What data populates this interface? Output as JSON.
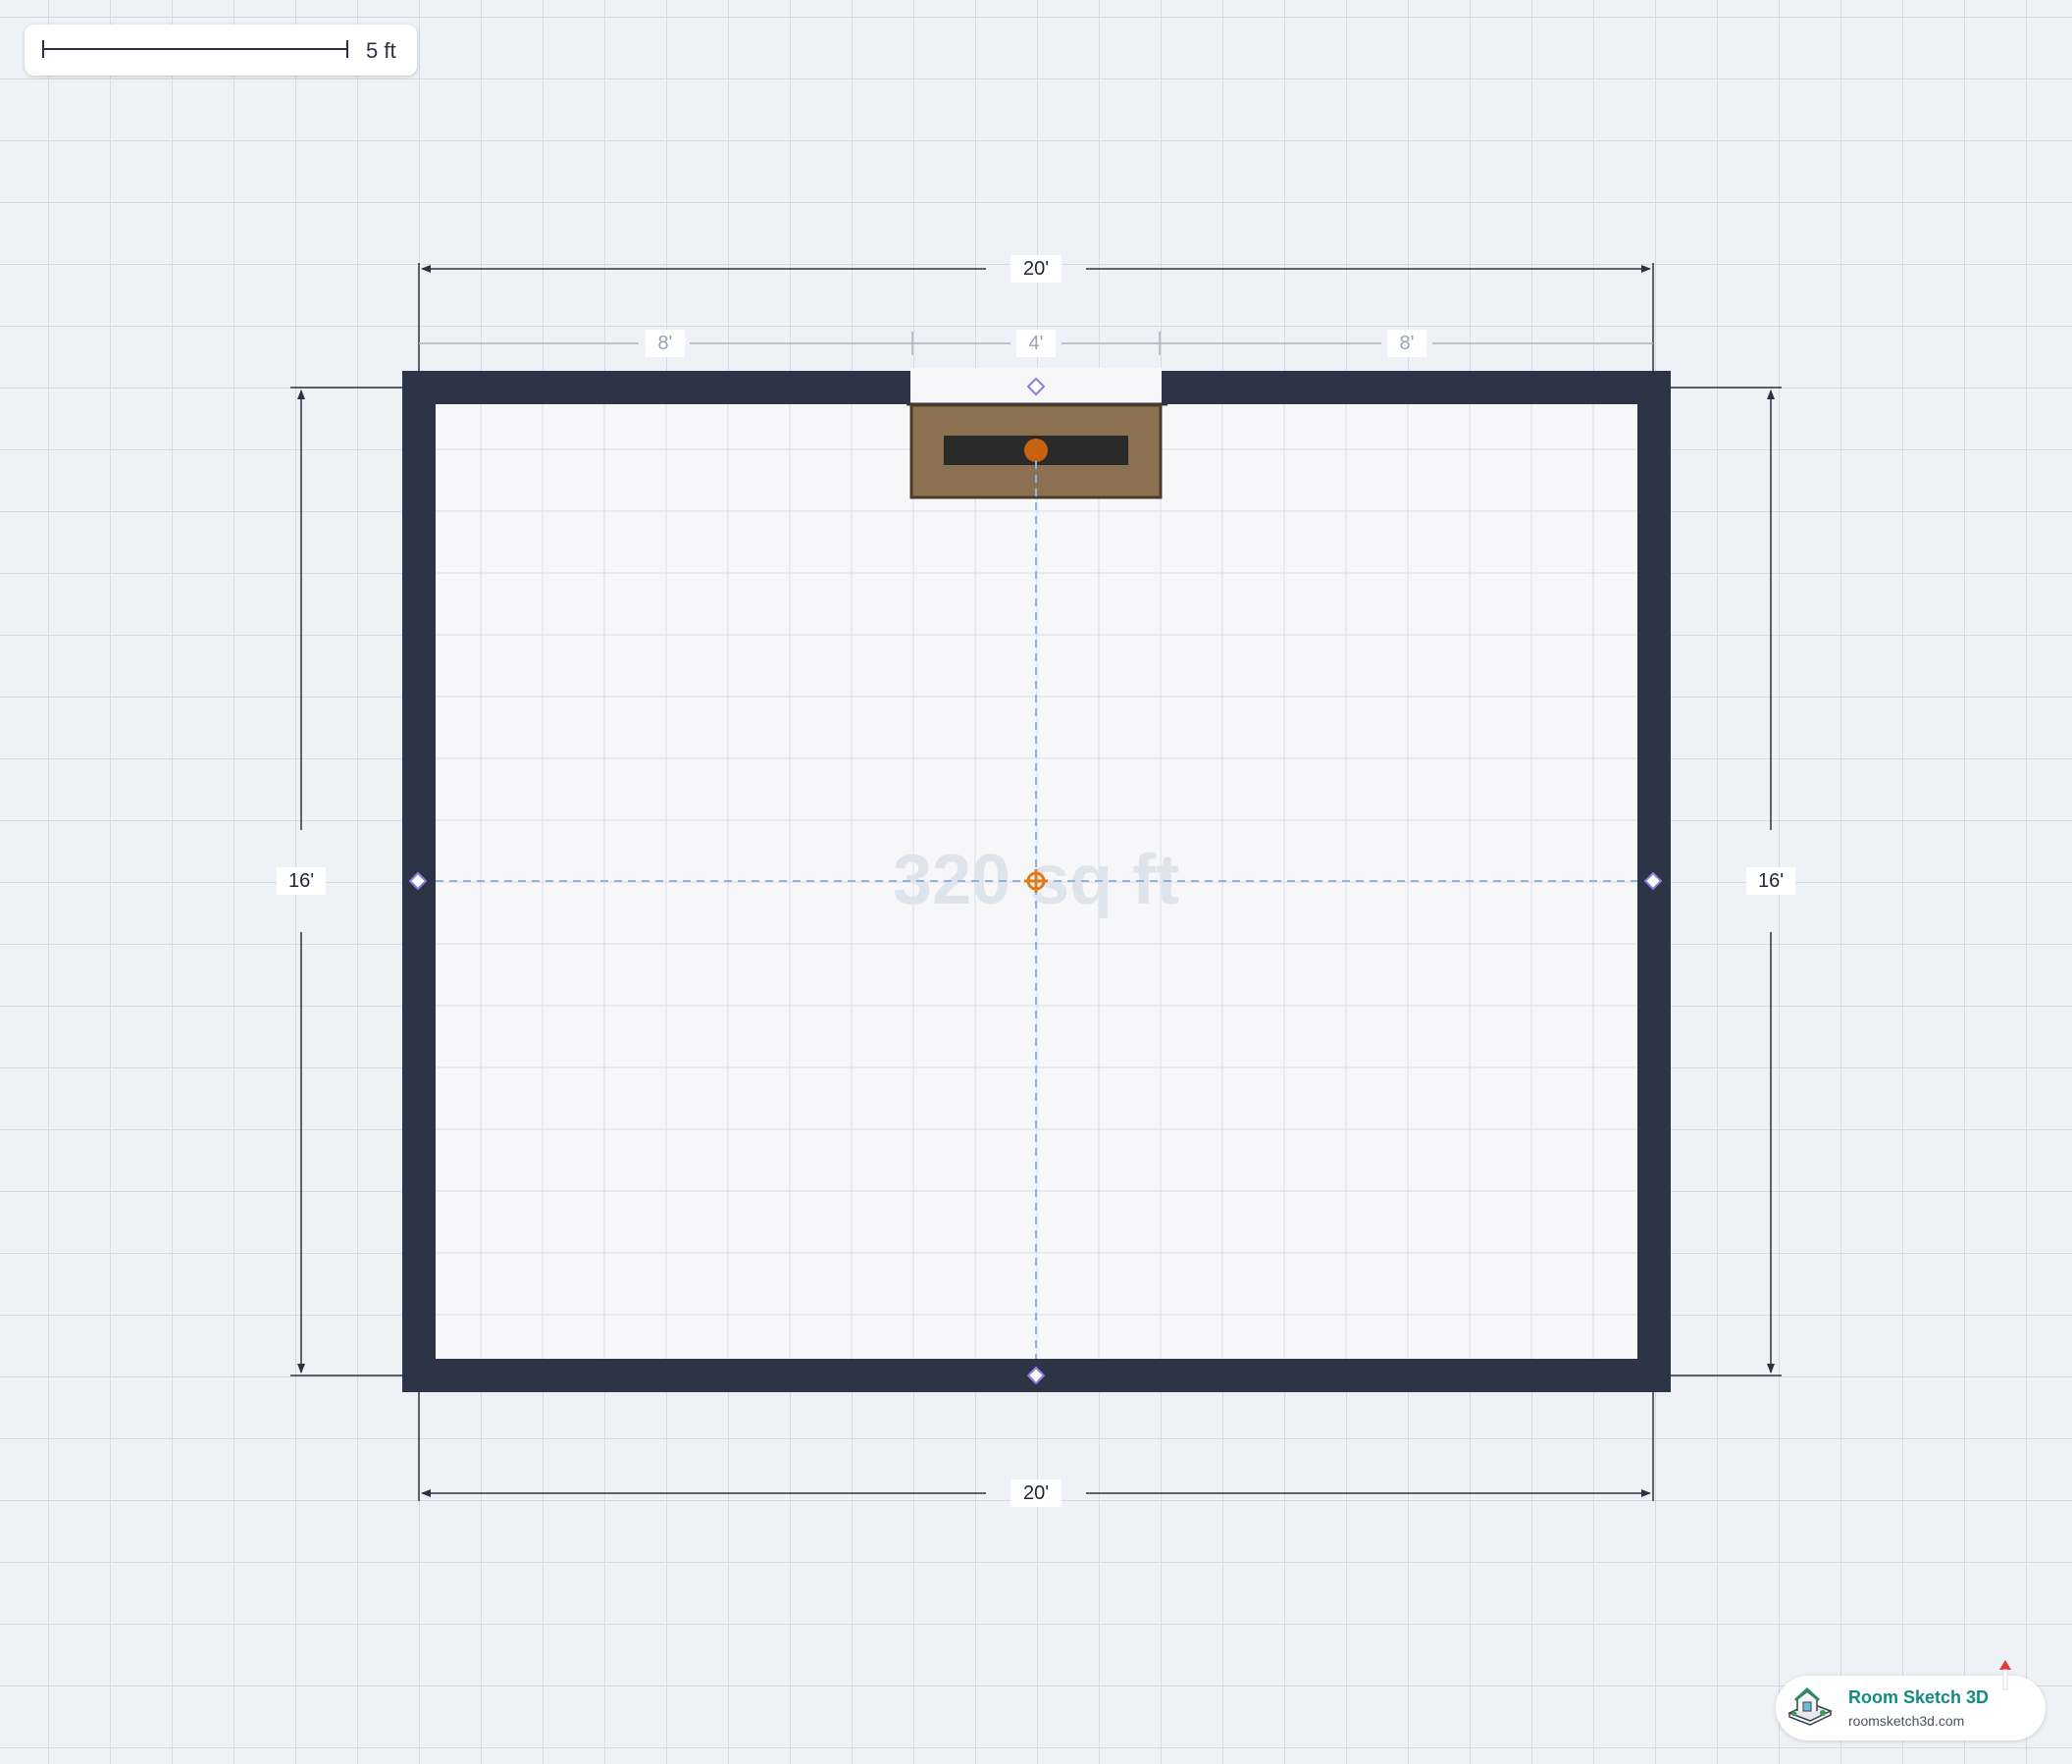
{
  "scale_bar": {
    "label": "5 ft"
  },
  "room": {
    "top_width": "20'",
    "bottom_width": "20'",
    "left_height": "16'",
    "right_height": "16'",
    "area": "320 sq ft",
    "top_segments": [
      "8'",
      "4'",
      "8'"
    ]
  },
  "colors": {
    "wall": "#2c3445",
    "floor": "#f7f7f9",
    "fireplace": "#8b7152",
    "firebox": "#2a2a2a",
    "handle": "#c8620e",
    "accent": "#e07b1a",
    "guide": "#8a7de0"
  },
  "icons": {
    "center_handle": "crosshair-handle-icon",
    "wall_handle": "diamond-handle-icon",
    "logo": "house-logo-icon"
  },
  "brand": {
    "name": "Room Sketch 3D",
    "url": "roomsketch3d.com"
  }
}
